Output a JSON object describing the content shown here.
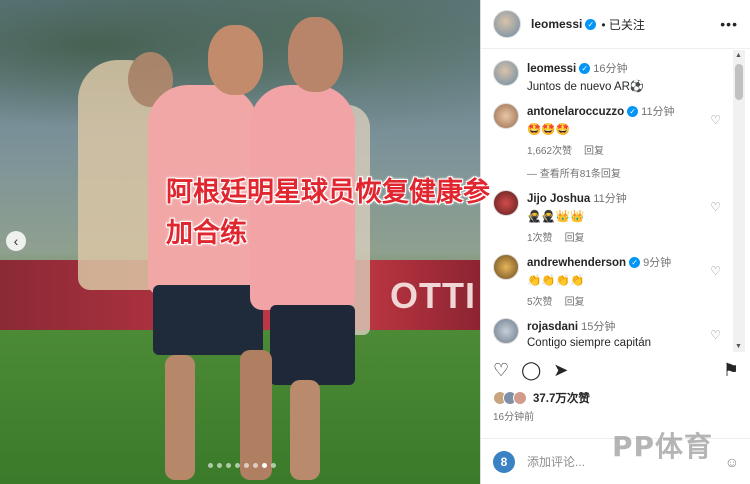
{
  "headline": {
    "line1": "阿根廷明星球员恢复健康参",
    "line2": "加合练"
  },
  "photo": {
    "banner_text": "OTTI",
    "nav_prev": "‹",
    "dots_total": 8,
    "dots_active": 7
  },
  "post": {
    "username": "leomessi",
    "follow_status": "已关注",
    "more_icon": "more-icon",
    "caption_user": "leomessi",
    "caption_time": "16分钟",
    "caption_text": "Juntos de nuevo AR⚽"
  },
  "comments": [
    {
      "user": "antonelaroccuzzo",
      "verified": true,
      "time": "11分钟",
      "text": "🤩🤩🤩",
      "likes": "1,662次赞",
      "reply": "回复",
      "replies": "查看所有81条回复"
    },
    {
      "user": "Jijo Joshua",
      "verified": false,
      "time": "11分钟",
      "text": "🥷🥷👑👑",
      "likes": "1次赞",
      "reply": "回复"
    },
    {
      "user": "andrewhenderson",
      "verified": true,
      "time": "9分钟",
      "text": "👏👏👏👏",
      "likes": "5次赞",
      "reply": "回复"
    },
    {
      "user": "rojasdani",
      "verified": false,
      "time": "15分钟",
      "text": "Contigo siempre capitán"
    }
  ],
  "actions": {
    "like_icon": "heart-icon",
    "comment_icon": "comment-icon",
    "share_icon": "share-icon",
    "save_icon": "bookmark-icon"
  },
  "likes_count": "37.7万次赞",
  "posted_time": "16分钟前",
  "add_comment": {
    "placeholder": "添加评论..."
  },
  "watermark": "PP体育",
  "colors": {
    "accent": "#0095f6",
    "headline": "#e0262f"
  }
}
